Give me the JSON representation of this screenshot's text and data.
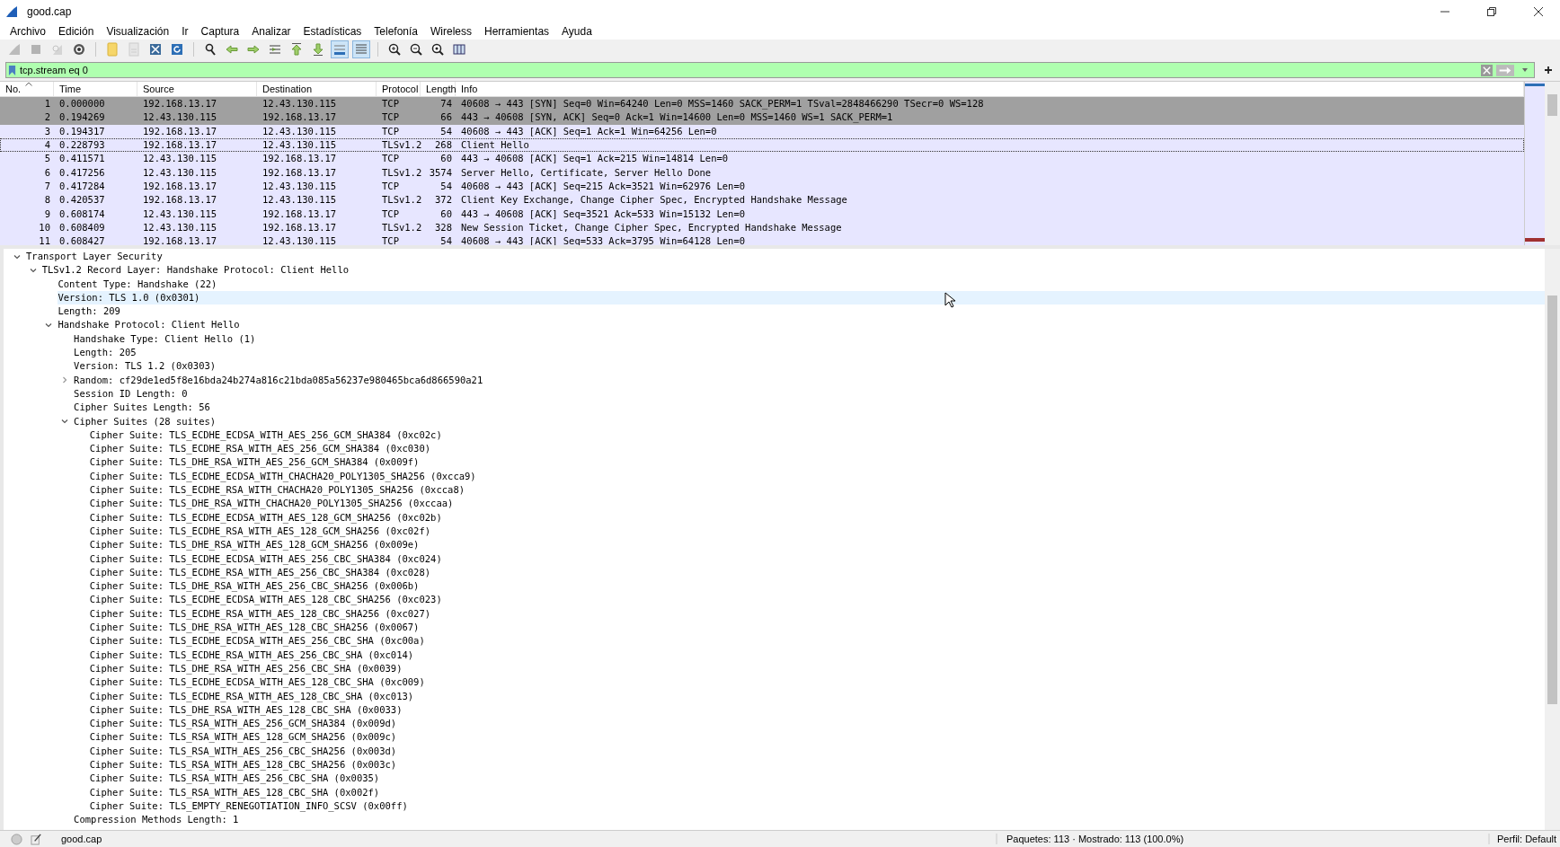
{
  "window": {
    "title": "good.cap"
  },
  "menu": [
    "Archivo",
    "Edición",
    "Visualización",
    "Ir",
    "Captura",
    "Analizar",
    "Estadísticas",
    "Telefonía",
    "Wireless",
    "Herramientas",
    "Ayuda"
  ],
  "toolbar": [
    {
      "buttons": [
        {
          "kind": "start",
          "disabled": true,
          "on": false
        },
        {
          "kind": "stop",
          "disabled": true,
          "on": false
        },
        {
          "kind": "restart",
          "disabled": true,
          "on": false
        },
        {
          "kind": "options",
          "disabled": false,
          "on": false
        }
      ]
    },
    {
      "buttons": [
        {
          "kind": "open",
          "disabled": false,
          "on": false
        },
        {
          "kind": "save",
          "disabled": true,
          "on": false
        },
        {
          "kind": "close",
          "disabled": false,
          "on": false
        },
        {
          "kind": "reload",
          "disabled": false,
          "on": false
        }
      ]
    },
    {
      "buttons": [
        {
          "kind": "find",
          "disabled": false,
          "on": false
        },
        {
          "kind": "back",
          "disabled": false,
          "on": false
        },
        {
          "kind": "forward",
          "disabled": false,
          "on": false
        },
        {
          "kind": "goto",
          "disabled": false,
          "on": false
        },
        {
          "kind": "first",
          "disabled": false,
          "on": false
        },
        {
          "kind": "last",
          "disabled": false,
          "on": false
        },
        {
          "kind": "autoscroll",
          "disabled": false,
          "on": true
        },
        {
          "kind": "colorize",
          "disabled": false,
          "on": true
        }
      ]
    },
    {
      "buttons": [
        {
          "kind": "zoom-in",
          "disabled": false,
          "on": false
        },
        {
          "kind": "zoom-out",
          "disabled": false,
          "on": false
        },
        {
          "kind": "zoom-reset",
          "disabled": false,
          "on": false
        },
        {
          "kind": "resize",
          "disabled": false,
          "on": false
        }
      ]
    }
  ],
  "filter": {
    "value": "tcp.stream eq 0",
    "valid": true
  },
  "packet_list": {
    "columns": [
      "No.",
      "Time",
      "Source",
      "Destination",
      "Protocol",
      "Length",
      "Info"
    ],
    "rows": [
      {
        "cells": [
          "1",
          "0.000000",
          "192.168.13.17",
          "12.43.130.115",
          "TCP",
          "74",
          "40608 → 443 [SYN] Seq=0 Win=64240 Len=0 MSS=1460 SACK_PERM=1 TSval=2848466290 TSecr=0 WS=128"
        ],
        "color": "#a0a0a0",
        "selected": false
      },
      {
        "cells": [
          "2",
          "0.194269",
          "12.43.130.115",
          "192.168.13.17",
          "TCP",
          "66",
          "443 → 40608 [SYN, ACK] Seq=0 Ack=1 Win=14600 Len=0 MSS=1460 WS=1 SACK_PERM=1"
        ],
        "color": "#a0a0a0",
        "selected": false
      },
      {
        "cells": [
          "3",
          "0.194317",
          "192.168.13.17",
          "12.43.130.115",
          "TCP",
          "54",
          "40608 → 443 [ACK] Seq=1 Ack=1 Win=64256 Len=0"
        ],
        "color": "#e7e6ff",
        "selected": false
      },
      {
        "cells": [
          "4",
          "0.228793",
          "192.168.13.17",
          "12.43.130.115",
          "TLSv1.2",
          "268",
          "Client Hello"
        ],
        "color": "#e7e6ff",
        "selected": true
      },
      {
        "cells": [
          "5",
          "0.411571",
          "12.43.130.115",
          "192.168.13.17",
          "TCP",
          "60",
          "443 → 40608 [ACK] Seq=1 Ack=215 Win=14814 Len=0"
        ],
        "color": "#e7e6ff",
        "selected": false
      },
      {
        "cells": [
          "6",
          "0.417256",
          "12.43.130.115",
          "192.168.13.17",
          "TLSv1.2",
          "3574",
          "Server Hello, Certificate, Server Hello Done"
        ],
        "color": "#e7e6ff",
        "selected": false
      },
      {
        "cells": [
          "7",
          "0.417284",
          "192.168.13.17",
          "12.43.130.115",
          "TCP",
          "54",
          "40608 → 443 [ACK] Seq=215 Ack=3521 Win=62976 Len=0"
        ],
        "color": "#e7e6ff",
        "selected": false
      },
      {
        "cells": [
          "8",
          "0.420537",
          "192.168.13.17",
          "12.43.130.115",
          "TLSv1.2",
          "372",
          "Client Key Exchange, Change Cipher Spec, Encrypted Handshake Message"
        ],
        "color": "#e7e6ff",
        "selected": false
      },
      {
        "cells": [
          "9",
          "0.608174",
          "12.43.130.115",
          "192.168.13.17",
          "TCP",
          "60",
          "443 → 40608 [ACK] Seq=3521 Ack=533 Win=15132 Len=0"
        ],
        "color": "#e7e6ff",
        "selected": false
      },
      {
        "cells": [
          "10",
          "0.608409",
          "12.43.130.115",
          "192.168.13.17",
          "TLSv1.2",
          "328",
          "New Session Ticket, Change Cipher Spec, Encrypted Handshake Message"
        ],
        "color": "#e7e6ff",
        "selected": false
      },
      {
        "cells": [
          "11",
          "0.608427",
          "192.168.13.17",
          "12.43.130.115",
          "TCP",
          "54",
          "40608 → 443 [ACK] Seq=533 Ack=3795 Win=64128 Len=0"
        ],
        "color": "#e7e6ff",
        "selected": false
      }
    ]
  },
  "details": [
    {
      "label": "Transport Layer Security",
      "expanded": true,
      "selected": false,
      "children": [
        {
          "label": "TLSv1.2 Record Layer: Handshake Protocol: Client Hello",
          "expanded": true,
          "selected": false,
          "children": [
            {
              "label": "Content Type: Handshake (22)",
              "selected": false
            },
            {
              "label": "Version: TLS 1.0 (0x0301)",
              "selected": true
            },
            {
              "label": "Length: 209",
              "selected": false
            },
            {
              "label": "Handshake Protocol: Client Hello",
              "expanded": true,
              "selected": false,
              "children": [
                {
                  "label": "Handshake Type: Client Hello (1)",
                  "selected": false
                },
                {
                  "label": "Length: 205",
                  "selected": false
                },
                {
                  "label": "Version: TLS 1.2 (0x0303)",
                  "selected": false
                },
                {
                  "label": "Random: cf29de1ed5f8e16bda24b274a816c21bda085a56237e980465bca6d866590a21",
                  "expanded": false,
                  "selected": false
                },
                {
                  "label": "Session ID Length: 0",
                  "selected": false
                },
                {
                  "label": "Cipher Suites Length: 56",
                  "selected": false
                },
                {
                  "label": "Cipher Suites (28 suites)",
                  "expanded": true,
                  "selected": false,
                  "children": [
                    {
                      "label": "Cipher Suite: TLS_ECDHE_ECDSA_WITH_AES_256_GCM_SHA384 (0xc02c)",
                      "selected": false
                    },
                    {
                      "label": "Cipher Suite: TLS_ECDHE_RSA_WITH_AES_256_GCM_SHA384 (0xc030)",
                      "selected": false
                    },
                    {
                      "label": "Cipher Suite: TLS_DHE_RSA_WITH_AES_256_GCM_SHA384 (0x009f)",
                      "selected": false
                    },
                    {
                      "label": "Cipher Suite: TLS_ECDHE_ECDSA_WITH_CHACHA20_POLY1305_SHA256 (0xcca9)",
                      "selected": false
                    },
                    {
                      "label": "Cipher Suite: TLS_ECDHE_RSA_WITH_CHACHA20_POLY1305_SHA256 (0xcca8)",
                      "selected": false
                    },
                    {
                      "label": "Cipher Suite: TLS_DHE_RSA_WITH_CHACHA20_POLY1305_SHA256 (0xccaa)",
                      "selected": false
                    },
                    {
                      "label": "Cipher Suite: TLS_ECDHE_ECDSA_WITH_AES_128_GCM_SHA256 (0xc02b)",
                      "selected": false
                    },
                    {
                      "label": "Cipher Suite: TLS_ECDHE_RSA_WITH_AES_128_GCM_SHA256 (0xc02f)",
                      "selected": false
                    },
                    {
                      "label": "Cipher Suite: TLS_DHE_RSA_WITH_AES_128_GCM_SHA256 (0x009e)",
                      "selected": false
                    },
                    {
                      "label": "Cipher Suite: TLS_ECDHE_ECDSA_WITH_AES_256_CBC_SHA384 (0xc024)",
                      "selected": false
                    },
                    {
                      "label": "Cipher Suite: TLS_ECDHE_RSA_WITH_AES_256_CBC_SHA384 (0xc028)",
                      "selected": false
                    },
                    {
                      "label": "Cipher Suite: TLS_DHE_RSA_WITH_AES_256_CBC_SHA256 (0x006b)",
                      "selected": false
                    },
                    {
                      "label": "Cipher Suite: TLS_ECDHE_ECDSA_WITH_AES_128_CBC_SHA256 (0xc023)",
                      "selected": false
                    },
                    {
                      "label": "Cipher Suite: TLS_ECDHE_RSA_WITH_AES_128_CBC_SHA256 (0xc027)",
                      "selected": false
                    },
                    {
                      "label": "Cipher Suite: TLS_DHE_RSA_WITH_AES_128_CBC_SHA256 (0x0067)",
                      "selected": false
                    },
                    {
                      "label": "Cipher Suite: TLS_ECDHE_ECDSA_WITH_AES_256_CBC_SHA (0xc00a)",
                      "selected": false
                    },
                    {
                      "label": "Cipher Suite: TLS_ECDHE_RSA_WITH_AES_256_CBC_SHA (0xc014)",
                      "selected": false
                    },
                    {
                      "label": "Cipher Suite: TLS_DHE_RSA_WITH_AES_256_CBC_SHA (0x0039)",
                      "selected": false
                    },
                    {
                      "label": "Cipher Suite: TLS_ECDHE_ECDSA_WITH_AES_128_CBC_SHA (0xc009)",
                      "selected": false
                    },
                    {
                      "label": "Cipher Suite: TLS_ECDHE_RSA_WITH_AES_128_CBC_SHA (0xc013)",
                      "selected": false
                    },
                    {
                      "label": "Cipher Suite: TLS_DHE_RSA_WITH_AES_128_CBC_SHA (0x0033)",
                      "selected": false
                    },
                    {
                      "label": "Cipher Suite: TLS_RSA_WITH_AES_256_GCM_SHA384 (0x009d)",
                      "selected": false
                    },
                    {
                      "label": "Cipher Suite: TLS_RSA_WITH_AES_128_GCM_SHA256 (0x009c)",
                      "selected": false
                    },
                    {
                      "label": "Cipher Suite: TLS_RSA_WITH_AES_256_CBC_SHA256 (0x003d)",
                      "selected": false
                    },
                    {
                      "label": "Cipher Suite: TLS_RSA_WITH_AES_128_CBC_SHA256 (0x003c)",
                      "selected": false
                    },
                    {
                      "label": "Cipher Suite: TLS_RSA_WITH_AES_256_CBC_SHA (0x0035)",
                      "selected": false
                    },
                    {
                      "label": "Cipher Suite: TLS_RSA_WITH_AES_128_CBC_SHA (0x002f)",
                      "selected": false
                    },
                    {
                      "label": "Cipher Suite: TLS_EMPTY_RENEGOTIATION_INFO_SCSV (0x00ff)",
                      "selected": false
                    }
                  ]
                },
                {
                  "label": "Compression Methods Length: 1",
                  "selected": false
                }
              ]
            }
          ]
        }
      ]
    }
  ],
  "status_bar": {
    "file": "good.cap",
    "packets": "Paquetes: 113 · Mostrado: 113 (100.0%)",
    "profile": "Perfil: Default"
  }
}
